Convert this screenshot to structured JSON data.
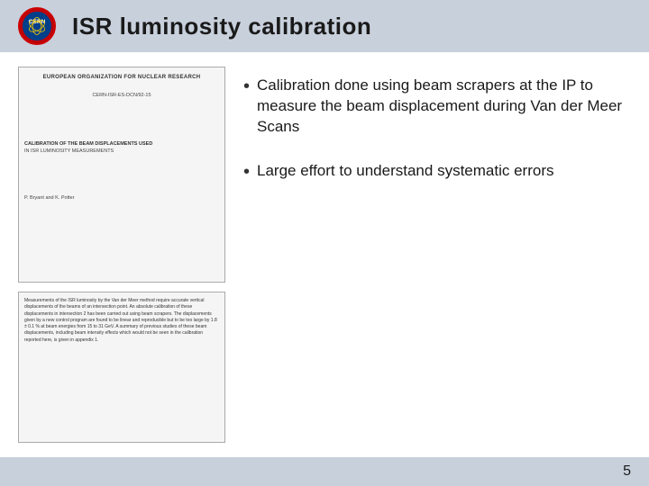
{
  "header": {
    "title": "ISR luminosity calibration",
    "logo_alt": "CERN"
  },
  "doc_top": {
    "org_name": "EUROPEAN ORGANIZATION FOR NUCLEAR RESEARCH",
    "ref_number": "CERN-ISR-ES-DCN/92-15",
    "section_title": "CALIBRATION OF THE BEAM DISPLACEMENTS USED",
    "subtitle": "IN ISR LUMINOSITY MEASUREMENTS",
    "author": "P. Bryant and K. Potter"
  },
  "doc_bottom": {
    "body_text": "Measurements of the ISR luminosity by the Van der Meer method require accurate vertical displacements of the beams of an intersection point. An absolute calibration of these displacements in intersection 2 has been carried out using beam scrapers. The displacements given by a new control program are found to be linear and reproducible but to be too large by 1.8 ± 0.1 % at beam energies from 15 to 31 GeV. A summary of previous studies of these beam displacements, including beam intensity effects which would not be seen in the calibration reported here, is given in appendix 1."
  },
  "bullets": [
    {
      "text": "Calibration done using beam scrapers at the IP to measure the beam displacement during Van der Meer Scans"
    },
    {
      "text": "Large effort to understand systematic errors"
    }
  ],
  "footer": {
    "page_number": "5"
  }
}
